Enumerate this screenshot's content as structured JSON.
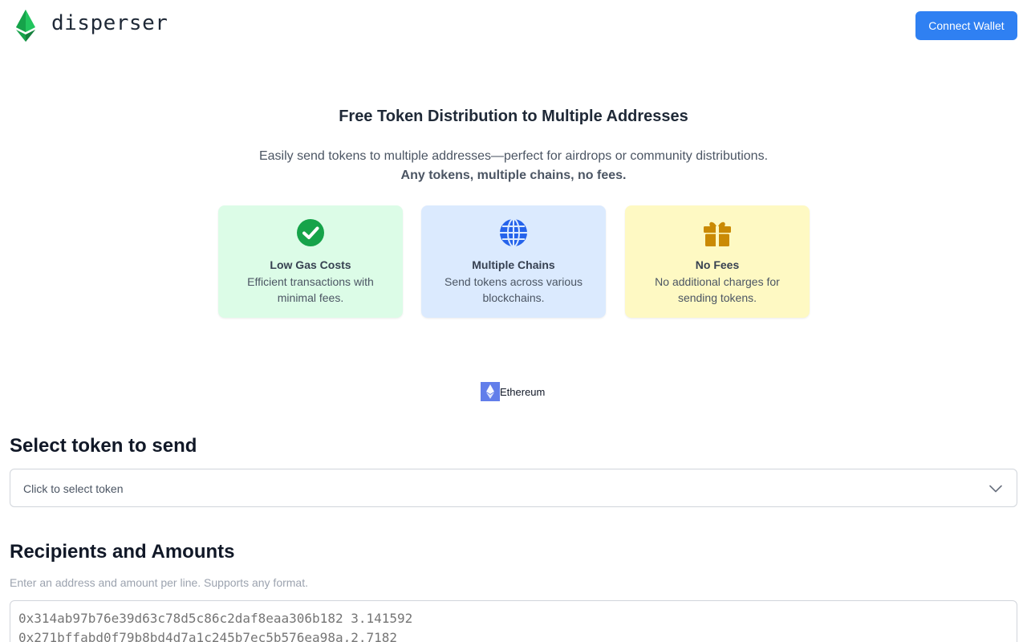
{
  "header": {
    "brand": "disperser",
    "connect_label": "Connect Wallet"
  },
  "hero": {
    "title": "Free Token Distribution to Multiple Addresses",
    "subtitle": "Easily send tokens to multiple addresses—perfect for airdrops or community distributions.",
    "tagline": "Any tokens, multiple chains, no fees."
  },
  "features": [
    {
      "icon": "check-circle-icon",
      "title": "Low Gas Costs",
      "desc": "Efficient transactions with minimal fees.",
      "bg": "#dcfce7",
      "color": "#16a34a"
    },
    {
      "icon": "globe-icon",
      "title": "Multiple Chains",
      "desc": "Send tokens across various blockchains.",
      "bg": "#dbeafe",
      "color": "#2563eb"
    },
    {
      "icon": "gift-icon",
      "title": "No Fees",
      "desc": "No additional charges for sending tokens.",
      "bg": "#fef9c3",
      "color": "#ca8a04"
    }
  ],
  "chain": {
    "label": "Ethereum",
    "icon": "ethereum-icon"
  },
  "token_section": {
    "title": "Select token to send",
    "placeholder": "Click to select token"
  },
  "recipients_section": {
    "title": "Recipients and Amounts",
    "hint": "Enter an address and amount per line. Supports any format.",
    "placeholder": "0x314ab97b76e39d63c78d5c86c2daf8eaa306b182 3.141592\n0x271bffabd0f79b8bd4d7a1c245b7ec5b576ea98a,2.7182"
  },
  "colors": {
    "accent": "#2f80f2",
    "logo": "#16a34a"
  }
}
